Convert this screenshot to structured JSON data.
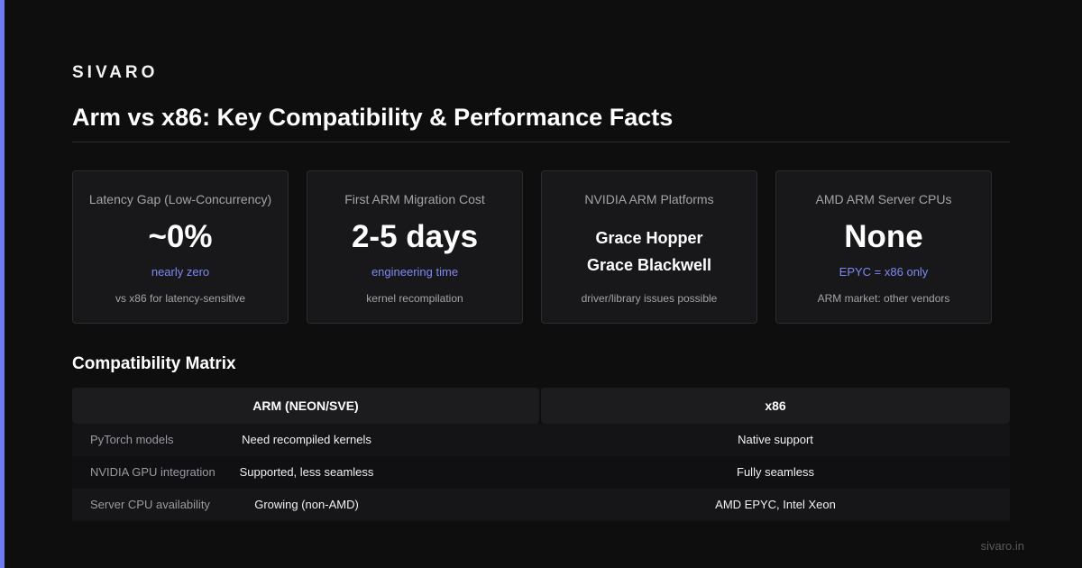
{
  "brand": "SIVARO",
  "title": "Arm vs x86: Key Compatibility & Performance Facts",
  "accent_color": "#6e7bf2",
  "cards": [
    {
      "label": "Latency Gap (Low-Concurrency)",
      "value": "~0%",
      "accent": "nearly zero",
      "note": "vs x86 for latency-sensitive"
    },
    {
      "label": "First ARM Migration Cost",
      "value": "2-5 days",
      "accent": "engineering time",
      "note": "kernel recompilation"
    },
    {
      "label": "NVIDIA ARM Platforms",
      "value_lines": [
        "Grace Hopper",
        "Grace Blackwell"
      ],
      "note": "driver/library issues possible"
    },
    {
      "label": "AMD ARM Server CPUs",
      "value": "None",
      "accent": "EPYC = x86 only",
      "note": "ARM market: other vendors"
    }
  ],
  "matrix": {
    "heading": "Compatibility Matrix",
    "columns": [
      "ARM (NEON/SVE)",
      "x86"
    ],
    "rows": [
      {
        "label": "PyTorch models",
        "arm": "Need recompiled kernels",
        "x86": "Native support"
      },
      {
        "label": "NVIDIA GPU integration",
        "arm": "Supported, less seamless",
        "x86": "Fully seamless"
      },
      {
        "label": "Server CPU availability",
        "arm": "Growing (non-AMD)",
        "x86": "AMD EPYC, Intel Xeon"
      }
    ]
  },
  "footer": {
    "site": "sivaro.in"
  }
}
